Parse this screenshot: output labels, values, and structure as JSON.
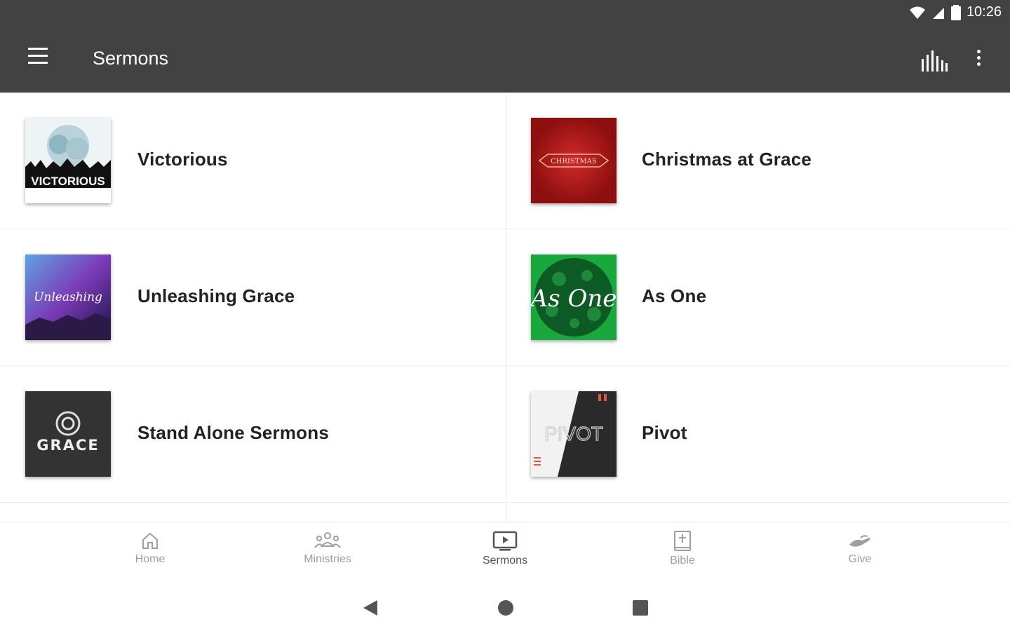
{
  "status": {
    "time": "10:26"
  },
  "appbar": {
    "title": "Sermons"
  },
  "sermons": [
    {
      "title": "Victorious",
      "thumb_text": "VICTORIOUS"
    },
    {
      "title": "Christmas at Grace",
      "thumb_text": "CHRISTMAS"
    },
    {
      "title": "Unleashing Grace",
      "thumb_text": "Unleashing"
    },
    {
      "title": "As One",
      "thumb_text": "As One"
    },
    {
      "title": "Stand Alone Sermons",
      "thumb_text": "GRACE"
    },
    {
      "title": "Pivot",
      "thumb_text": "PIVOT"
    }
  ],
  "bottom_nav": [
    {
      "label": "Home",
      "icon": "home-icon"
    },
    {
      "label": "Ministries",
      "icon": "people-icon"
    },
    {
      "label": "Sermons",
      "icon": "tv-play-icon",
      "active": true
    },
    {
      "label": "Bible",
      "icon": "bible-icon"
    },
    {
      "label": "Give",
      "icon": "give-hand-icon"
    }
  ],
  "colors": {
    "appbar": "#424242",
    "nav_inactive": "#9e9e9e",
    "nav_active": "#555555"
  }
}
